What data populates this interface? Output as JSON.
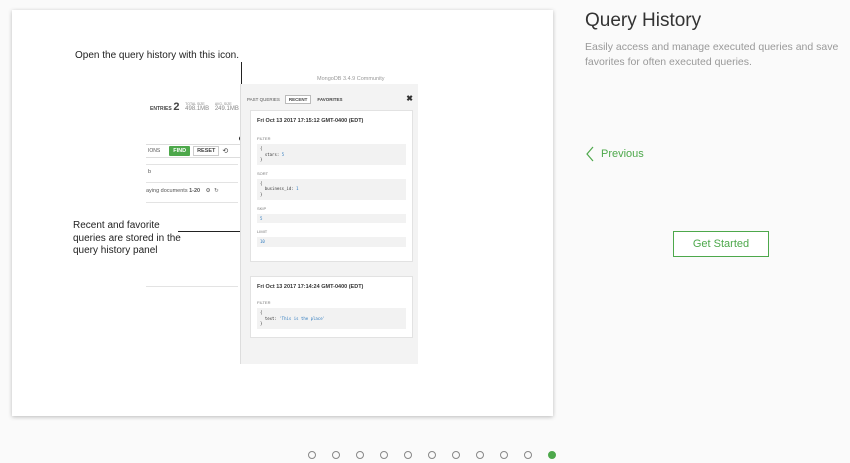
{
  "illustration": {
    "callout_top": "Open the query history with this icon.",
    "callout_left": "Recent and favorite queries are stored in the query history panel",
    "version": "MongoDB 3.4.9 Community",
    "stats_label": "ENTRIES",
    "stats_count": "2",
    "total_size_label": "TOTAL SIZE",
    "total_size_value": "498.1MB",
    "avg_size_label": "AVG. SIZE",
    "avg_size_value": "249.1MB",
    "options_label": "IONS",
    "find_label": "FIND",
    "reset_label": "RESET",
    "history_icon": "history-icon",
    "row_b": "b",
    "displaying_prefix": "aying documents ",
    "displaying_range": "1-20",
    "panel": {
      "label": "PAST QUERIES",
      "tabs": [
        "RECENT",
        "FAVORITES"
      ],
      "close": "✖",
      "queries": [
        {
          "date": "Fri Oct 13 2017 17:15:12 GMT-0400 (EDT)",
          "filter_label": "FILTER",
          "filter_open": "{",
          "filter_line": "  stars: ",
          "filter_value": "5",
          "filter_close": "}",
          "sort_label": "SORT",
          "sort_open": "{",
          "sort_line": "  business_id: ",
          "sort_value": "1",
          "sort_close": "}",
          "skip_label": "SKIP",
          "skip_value": "5",
          "limit_label": "LIMIT",
          "limit_value": "10"
        },
        {
          "date": "Fri Oct 13 2017 17:14:24 GMT-0400 (EDT)",
          "filter_label": "FILTER",
          "filter_open": "{",
          "filter_line": "  text: ",
          "filter_value": "'This is the place'",
          "filter_close": "}"
        }
      ]
    }
  },
  "info": {
    "title": "Query History",
    "description": "Easily access and manage executed queries and save favorites for often executed queries.",
    "previous_label": "Previous",
    "previous_icon": "chevron-left-icon",
    "get_started_label": "Get Started"
  },
  "pager": {
    "total": 11,
    "active_index": 10
  },
  "colors": {
    "accent": "#4da84b",
    "muted_text": "#999999"
  }
}
